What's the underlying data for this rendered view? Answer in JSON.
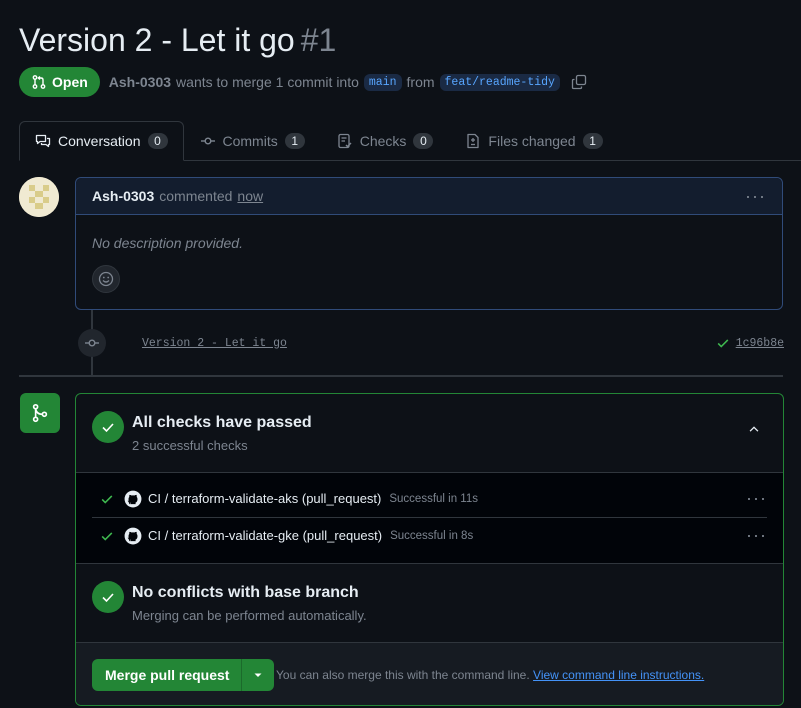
{
  "pr": {
    "title": "Version 2 - Let it go",
    "number": "#1",
    "state": "Open",
    "author": "Ash-0303",
    "merge_text": "wants to merge 1 commit into",
    "base_branch": "main",
    "from_text": "from",
    "head_branch": "feat/readme-tidy"
  },
  "tabs": [
    {
      "label": "Conversation",
      "count": "0"
    },
    {
      "label": "Commits",
      "count": "1"
    },
    {
      "label": "Checks",
      "count": "0"
    },
    {
      "label": "Files changed",
      "count": "1"
    }
  ],
  "comment": {
    "author": "Ash-0303",
    "action": "commented",
    "time": "now",
    "body": "No description provided."
  },
  "commit": {
    "message": "Version 2 - Let it go",
    "sha": "1c96b8e"
  },
  "checks": {
    "title": "All checks have passed",
    "subtitle": "2 successful checks",
    "items": [
      {
        "name": "CI / terraform-validate-aks (pull_request)",
        "result": "Successful in 11s"
      },
      {
        "name": "CI / terraform-validate-gke (pull_request)",
        "result": "Successful in 8s"
      }
    ]
  },
  "conflicts": {
    "title": "No conflicts with base branch",
    "subtitle": "Merging can be performed automatically."
  },
  "merge": {
    "button_label": "Merge pull request",
    "hint": "You can also merge this with the command line.",
    "link": "View command line instructions."
  },
  "colors": {
    "background": "#0d1117",
    "success": "#238636",
    "accent": "#58a6ff"
  }
}
